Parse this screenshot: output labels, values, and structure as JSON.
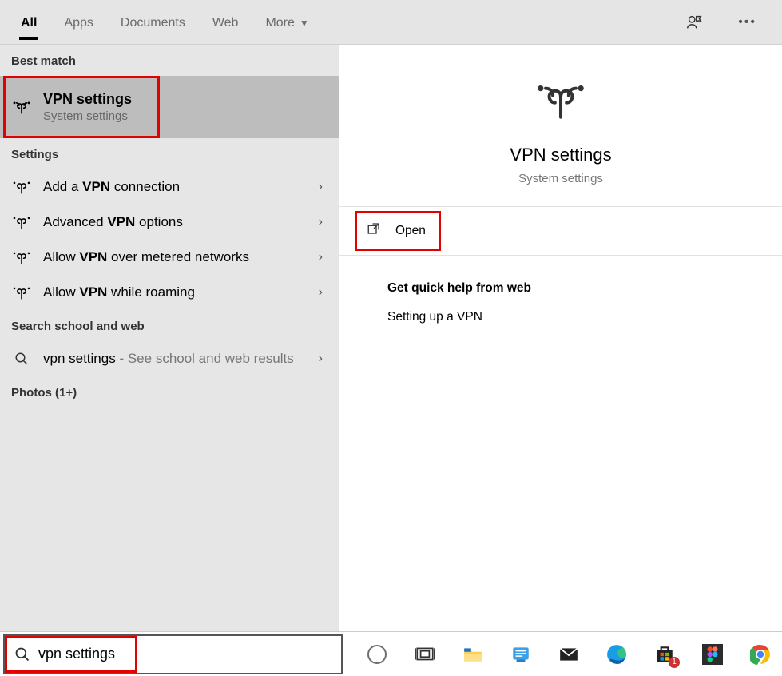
{
  "tabs": {
    "all": "All",
    "apps": "Apps",
    "documents": "Documents",
    "web": "Web",
    "more": "More"
  },
  "left": {
    "best_match_header": "Best match",
    "best": {
      "title": "VPN settings",
      "subtitle": "System settings"
    },
    "settings_header": "Settings",
    "items": [
      {
        "pre": "Add a ",
        "bold": "VPN",
        "post": " connection"
      },
      {
        "pre": "Advanced ",
        "bold": "VPN",
        "post": " options"
      },
      {
        "pre": "Allow ",
        "bold": "VPN",
        "post": " over metered networks"
      },
      {
        "pre": "Allow ",
        "bold": "VPN",
        "post": " while roaming"
      }
    ],
    "search_header": "Search school and web",
    "search_item": {
      "query": "vpn settings",
      "suffix": " - See school and web results"
    },
    "photos_header": "Photos (1+)"
  },
  "right": {
    "title": "VPN settings",
    "subtitle": "System settings",
    "open_action": "Open",
    "help_header": "Get quick help from web",
    "help_link": "Setting up a VPN"
  },
  "search": {
    "value": "vpn settings"
  },
  "taskbar": {
    "store_badge": "1"
  }
}
